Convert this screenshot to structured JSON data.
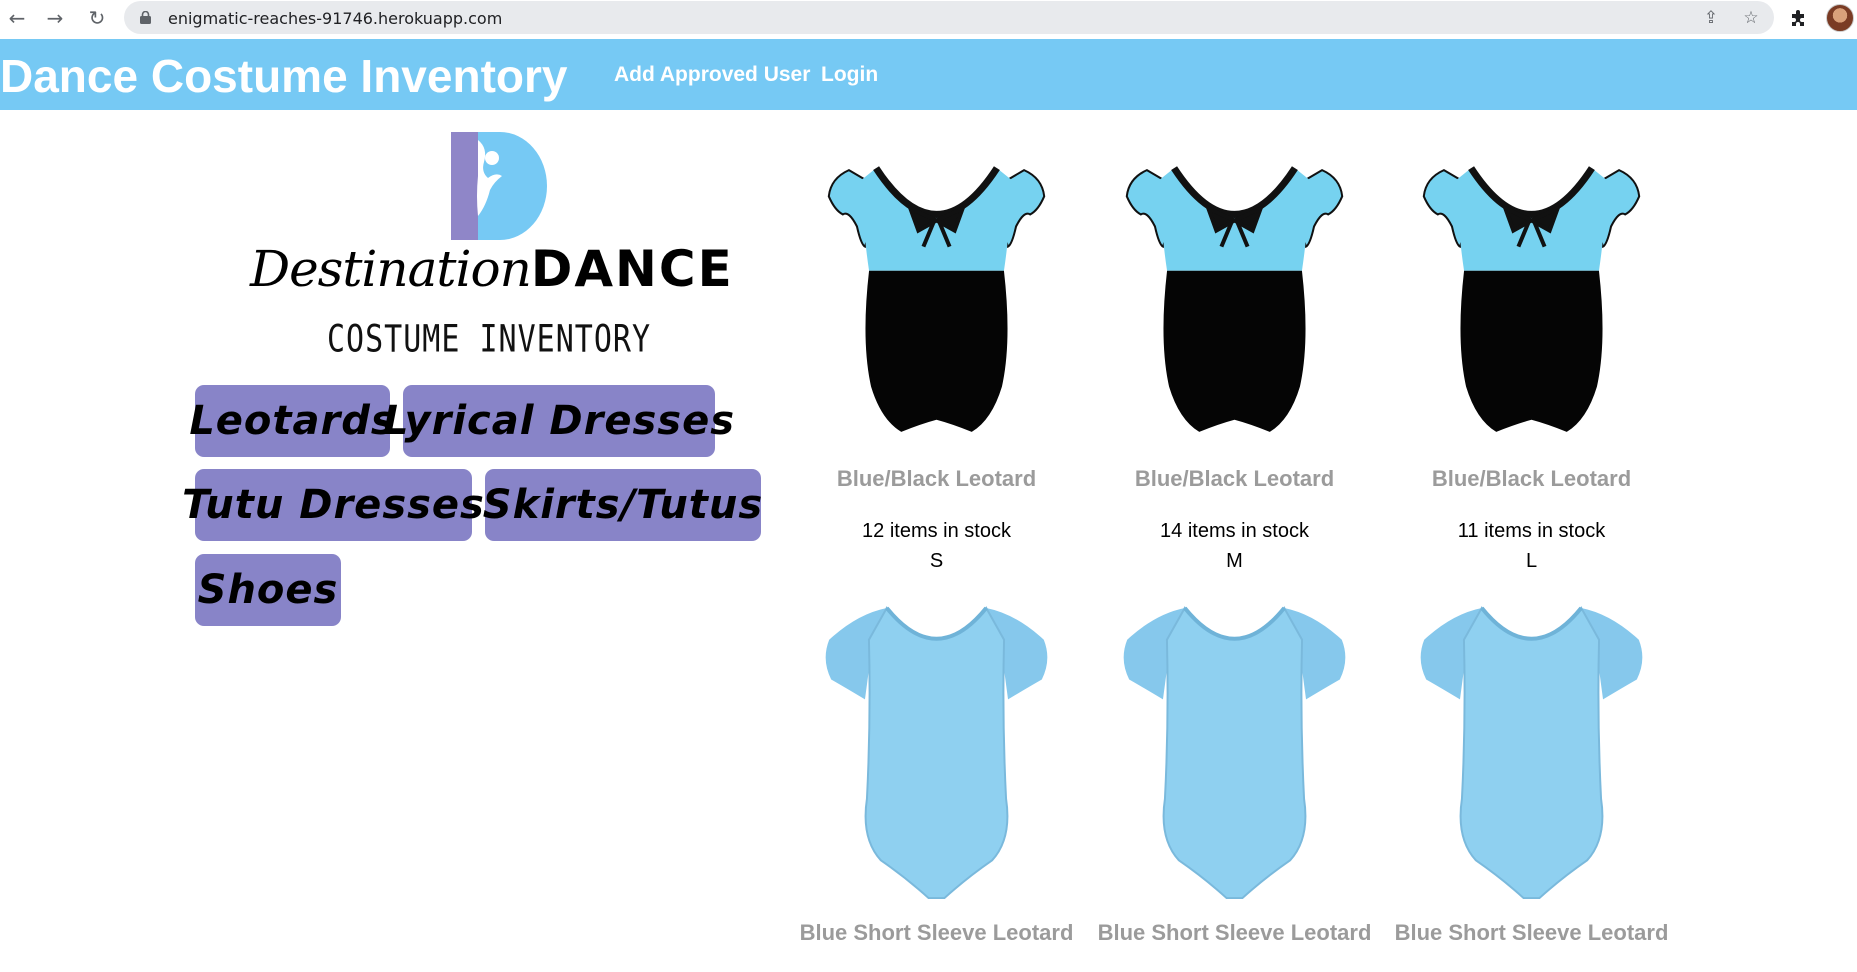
{
  "browser": {
    "url": "enigmatic-reaches-91746.herokuapp.com",
    "icons": {
      "back": "arrow-left",
      "forward": "arrow-right",
      "reload": "reload",
      "lock": "lock",
      "share": "share",
      "bookmark": "star",
      "extensions": "puzzle-piece",
      "profile": "avatar"
    }
  },
  "header": {
    "title": "Dance Costume Inventory",
    "nav": [
      {
        "label": "Add Approved User"
      },
      {
        "label": "Login"
      }
    ],
    "background_color": "#76c9f4"
  },
  "logo": {
    "word_script": "Destination",
    "word_bold": "DANCE",
    "subtitle": "COSTUME INVENTORY"
  },
  "categories": [
    {
      "label": "Leotards"
    },
    {
      "label": "Lyrical Dresses"
    },
    {
      "label": "Tutu Dresses"
    },
    {
      "label": "Skirts/Tutus"
    },
    {
      "label": "Shoes"
    }
  ],
  "category_button_color": "#8884c8",
  "products": [
    {
      "name": "Blue/Black Leotard",
      "stock": "12 items in stock",
      "size": "S",
      "image": "leotard-blue-black-icon"
    },
    {
      "name": "Blue/Black Leotard",
      "stock": "14 items in stock",
      "size": "M",
      "image": "leotard-blue-black-icon"
    },
    {
      "name": "Blue/Black Leotard",
      "stock": "11 items in stock",
      "size": "L",
      "image": "leotard-blue-black-icon"
    },
    {
      "name": "Blue Short Sleeve Leotard",
      "image": "leotard-blue-short-sleeve-icon"
    },
    {
      "name": "Blue Short Sleeve Leotard",
      "image": "leotard-blue-short-sleeve-icon"
    },
    {
      "name": "Blue Short Sleeve Leotard",
      "image": "leotard-blue-short-sleeve-icon"
    }
  ]
}
